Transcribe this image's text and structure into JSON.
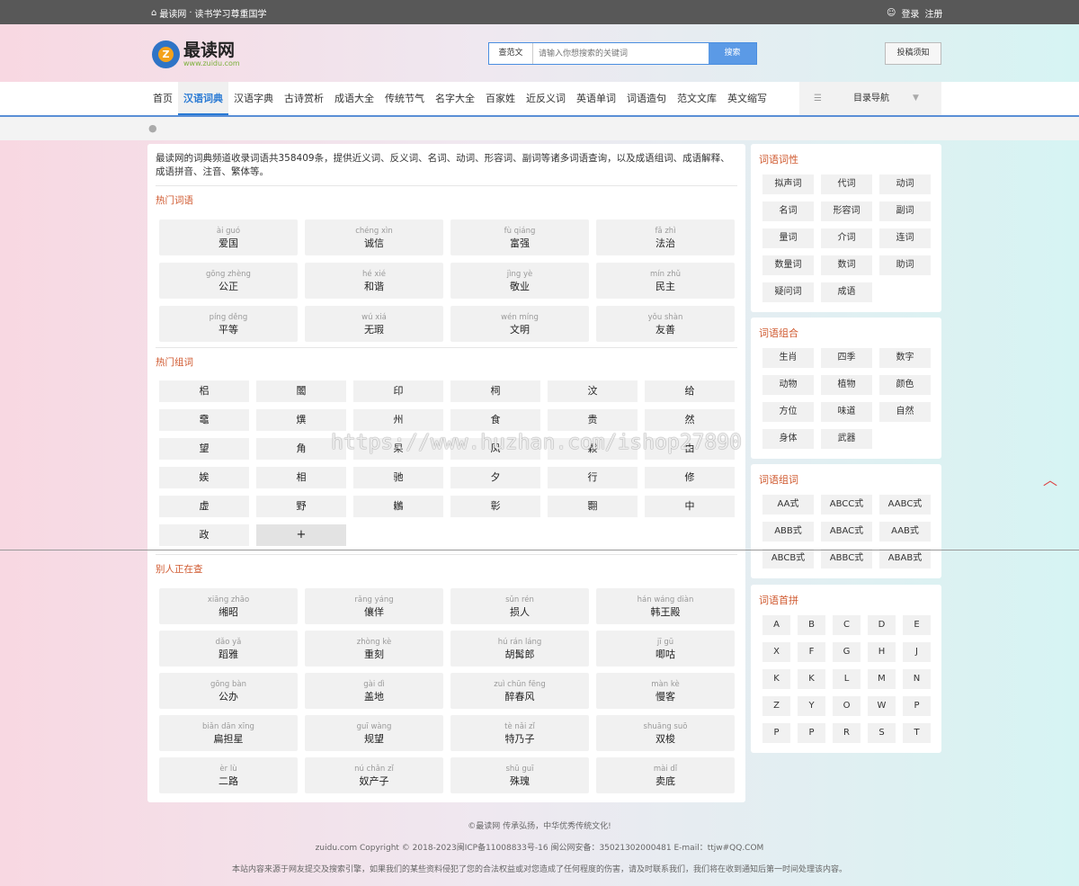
{
  "topbar": {
    "site": "最读网",
    "slogan": "读书学习尊重国学",
    "login": "登录",
    "register": "注册"
  },
  "logo": {
    "name": "最读网",
    "domain": "www.zuidu.com"
  },
  "search": {
    "category": "查范文",
    "placeholder": "请输入你想搜索的关键词",
    "button": "搜索"
  },
  "contribute": "投稿须知",
  "nav": {
    "items": [
      "首页",
      "汉语词典",
      "汉语字典",
      "古诗赏析",
      "成语大全",
      "传统节气",
      "名字大全",
      "百家姓",
      "近反义词",
      "英语单词",
      "词语造句",
      "范文文库",
      "英文缩写"
    ],
    "active": "汉语词典",
    "dir_label": "目录导航"
  },
  "intro": "最读网的词典频道收录词语共358409条，提供近义词、反义词、名词、动词、形容词、副词等诸多词语查询，以及成语组词、成语解释、成语拼音、注音、繁体等。",
  "hot_words": {
    "title": "热门词语",
    "items": [
      {
        "py": "ài guó",
        "w": "爱国"
      },
      {
        "py": "chéng xìn",
        "w": "诚信"
      },
      {
        "py": "fù qiáng",
        "w": "富强"
      },
      {
        "py": "fǎ zhì",
        "w": "法治"
      },
      {
        "py": "gōng zhèng",
        "w": "公正"
      },
      {
        "py": "hé xié",
        "w": "和谐"
      },
      {
        "py": "jìng yè",
        "w": "敬业"
      },
      {
        "py": "mín zhǔ",
        "w": "民主"
      },
      {
        "py": "píng děng",
        "w": "平等"
      },
      {
        "py": "wú xiá",
        "w": "无瑕"
      },
      {
        "py": "wén míng",
        "w": "文明"
      },
      {
        "py": "yǒu shàn",
        "w": "友善"
      }
    ]
  },
  "hot_compose": {
    "title": "热门组词",
    "items": [
      "梠",
      "闟",
      "印",
      "柌",
      "汶",
      "给",
      "鼀",
      "熼",
      "州",
      "食",
      "贵",
      "然",
      "望",
      "角",
      "杲",
      "凤",
      "鬏",
      "由",
      "娭",
      "相",
      "驰",
      "夕",
      "行",
      "修",
      "虚",
      "野",
      "鶒",
      "彰",
      "翾",
      "中",
      "政"
    ],
    "plus": "+"
  },
  "others": {
    "title": "别人正在查",
    "items": [
      {
        "py": "xiāng zhāo",
        "w": "缃昭"
      },
      {
        "py": "rǎng yáng",
        "w": "儴佯"
      },
      {
        "py": "sǔn rén",
        "w": "损人"
      },
      {
        "py": "hán wáng diàn",
        "w": "韩王殿"
      },
      {
        "py": "dǎo yǎ",
        "w": "蹈雅"
      },
      {
        "py": "zhòng kè",
        "w": "重刻"
      },
      {
        "py": "hú rán láng",
        "w": "胡髯郎"
      },
      {
        "py": "jī gū",
        "w": "唧咕"
      },
      {
        "py": "gōng bàn",
        "w": "公办"
      },
      {
        "py": "gài dì",
        "w": "盖地"
      },
      {
        "py": "zuì chūn fēng",
        "w": "醉春风"
      },
      {
        "py": "màn kè",
        "w": "慢客"
      },
      {
        "py": "biǎn dān xīng",
        "w": "扁担星"
      },
      {
        "py": "guī wàng",
        "w": "规望"
      },
      {
        "py": "tè nǎi zǐ",
        "w": "特乃子"
      },
      {
        "py": "shuāng suō",
        "w": "双梭"
      },
      {
        "py": "èr lù",
        "w": "二路"
      },
      {
        "py": "nú chǎn zǐ",
        "w": "奴产子"
      },
      {
        "py": "shū guī",
        "w": "殊瑰"
      },
      {
        "py": "mài dǐ",
        "w": "卖底"
      }
    ]
  },
  "side_pos": {
    "title": "词语词性",
    "items": [
      "拟声词",
      "代词",
      "动词",
      "名词",
      "形容词",
      "副词",
      "量词",
      "介词",
      "连词",
      "数量词",
      "数词",
      "助词",
      "疑问词",
      "成语"
    ]
  },
  "side_combo": {
    "title": "词语组合",
    "items": [
      "生肖",
      "四季",
      "数字",
      "动物",
      "植物",
      "颜色",
      "方位",
      "味道",
      "自然",
      "身体",
      "武器"
    ]
  },
  "side_form": {
    "title": "词语组词",
    "items": [
      "AA式",
      "ABCC式",
      "AABC式",
      "ABB式",
      "ABAC式",
      "AAB式",
      "ABCB式",
      "ABBC式",
      "ABAB式"
    ]
  },
  "side_letters": {
    "title": "词语首拼",
    "items": [
      "A",
      "B",
      "C",
      "D",
      "E",
      "X",
      "F",
      "G",
      "H",
      "J",
      "K",
      "K",
      "L",
      "M",
      "N",
      "Z",
      "Y",
      "O",
      "W",
      "P",
      "P",
      "P",
      "R",
      "S",
      "T"
    ]
  },
  "watermark": "https://www.huzhan.com/ishop27890",
  "footer": {
    "line1": "©最读网 传承弘扬，中华优秀传统文化!",
    "line2": "zuidu.com Copyright © 2018-2023闽ICP备11008833号-16 闽公网安备：35021302000481 E-mail：ttjw#QQ.COM",
    "line3": "本站内容来源于网友提交及搜索引擎，如果我们的某些资料侵犯了您的合法权益或对您造成了任何程度的伤害，请及时联系我们，我们将在收到通知后第一时间处理该内容。"
  },
  "colors": {
    "accent": "#2a7ad4",
    "section": "#d05a30",
    "topbar": "#585858"
  }
}
